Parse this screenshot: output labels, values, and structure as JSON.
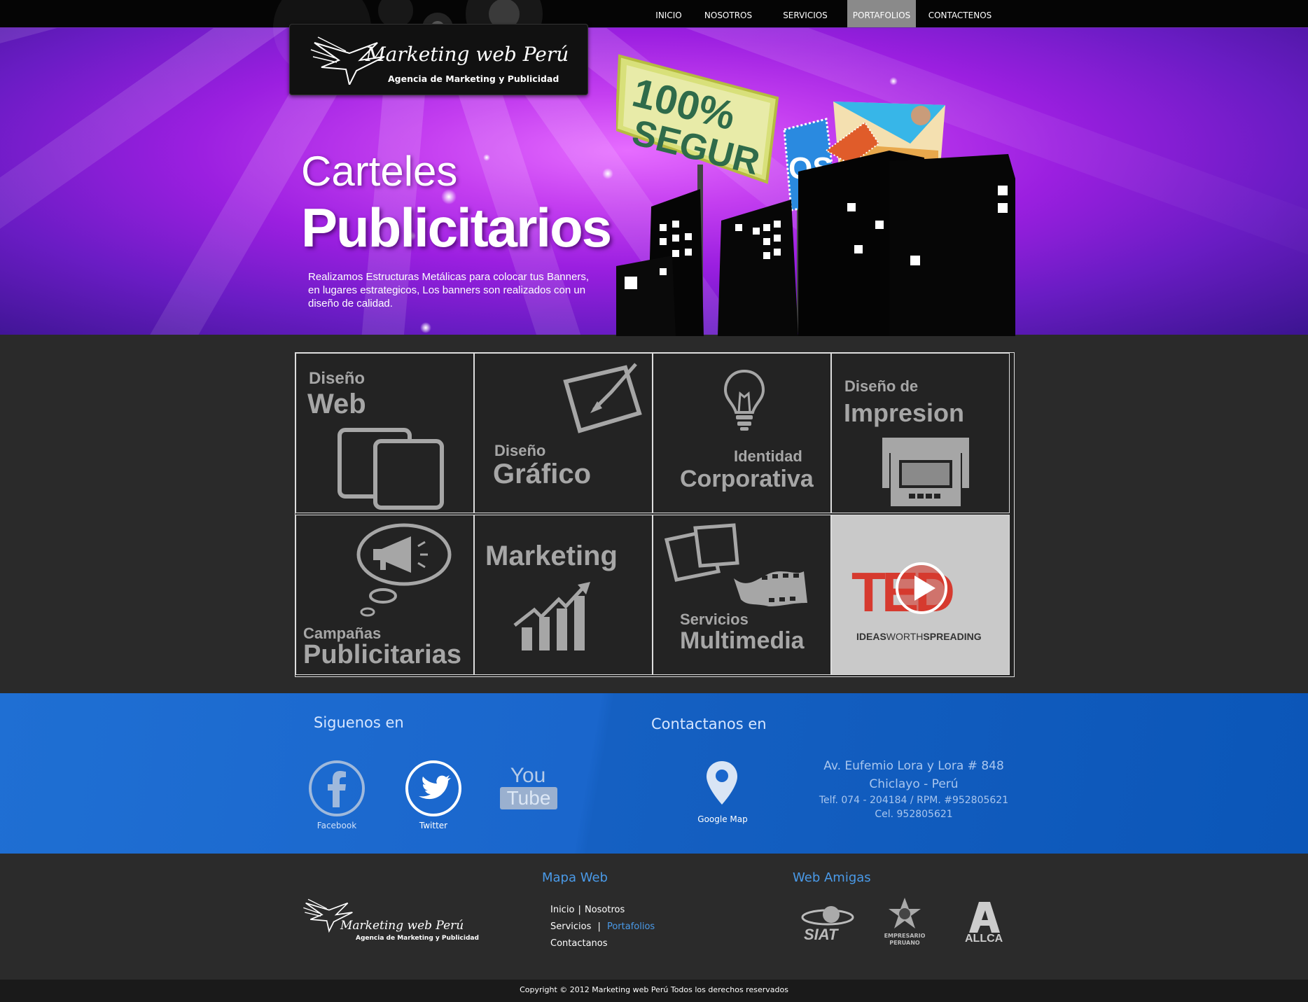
{
  "nav": {
    "items": [
      "INICIO",
      "NOSOTROS",
      "SERVICIOS",
      "PORTAFOLIOS",
      "CONTACTENOS"
    ],
    "active": "PORTAFOLIOS"
  },
  "logo": {
    "name": "Marketing web Perú",
    "tagline": "Agencia de Marketing y Publicidad"
  },
  "hero": {
    "title_line1": "Carteles",
    "title_line2": "Publicitarios",
    "description": "Realizamos Estructuras Metálicas para colocar tus Banners, en lugares estrategicos, Los banners son realizados con un diseño de calidad.",
    "billboard_line1": "100%",
    "billboard_line2": "SEGUR",
    "billboard_line3": "OS"
  },
  "services": [
    {
      "small": "Diseño",
      "big": "Web"
    },
    {
      "small": "Diseño",
      "big": "Gráfico"
    },
    {
      "small": "Identidad",
      "big": "Corporativa"
    },
    {
      "small": "Diseño de",
      "big": "Impresion"
    },
    {
      "small": "Campañas",
      "big": "Publicitarias"
    },
    {
      "small": "",
      "big": "Marketing"
    },
    {
      "small": "Servicios",
      "big": "Multimedia"
    },
    {
      "ted_logo": "TED",
      "ted_tagline_a": "IDEAS",
      "ted_tagline_b": "WORTH",
      "ted_tagline_c": "SPREADING"
    }
  ],
  "social": {
    "title": "Siguenos en",
    "facebook": "Facebook",
    "twitter": "Twitter",
    "youtube_you": "You",
    "youtube_tube": "Tube"
  },
  "contact": {
    "title": "Contactanos en",
    "map_label": "Google Map",
    "address": "Av. Eufemio Lora y Lora # 848",
    "city": "Chiclayo - Perú",
    "phone": "Telf. 074 - 204184 / RPM. #952805621",
    "cell": "Cel. 952805621"
  },
  "footer": {
    "sitemap_title": "Mapa Web",
    "links": {
      "inicio": "Inicio",
      "sep": "|",
      "nosotros": "Nosotros",
      "servicios": "Servicios",
      "portafolios": "Portafolios",
      "contactanos": "Contactanos"
    },
    "friends_title": "Web Amigas",
    "friend1": "SIAT",
    "friend2_a": "EMPRESARIO",
    "friend2_b": "PERUANO",
    "friend3": "ALLCA",
    "copyright": "Copyright © 2012   Marketing web Perú Todos los derechos reservados"
  },
  "colors": {
    "nav_active": "#8a8a8a",
    "hero_purple": "#9b1fe0",
    "band_blue": "#1a66cc",
    "footer_accent": "#4a9ae8",
    "ted_red": "#d63a2f"
  }
}
